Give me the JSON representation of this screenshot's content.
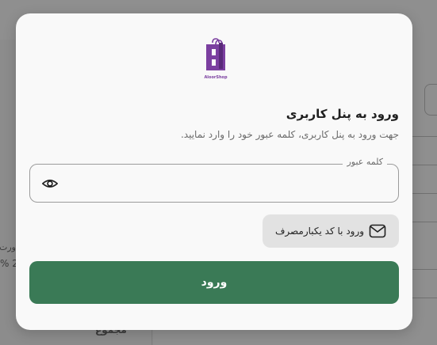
{
  "background": {
    "side_text": "ورت",
    "side_percent": "% 2",
    "total_label": "مجموع"
  },
  "modal": {
    "logo_text": "AloorShop",
    "title": "ورود به پنل کاربری",
    "subtitle": "جهت ورود به پنل کاربری، کلمه عبور خود را وارد نمایید.",
    "password": {
      "label": "کلمه عبور",
      "value": ""
    },
    "otp_button_label": "ورود با کد یکبارمصرف",
    "login_button_label": "ورود",
    "icons": {
      "visibility": "eye-icon",
      "otp": "mail-icon"
    },
    "colors": {
      "primary": "#3a7a56",
      "brand": "#7b3fa0"
    }
  }
}
